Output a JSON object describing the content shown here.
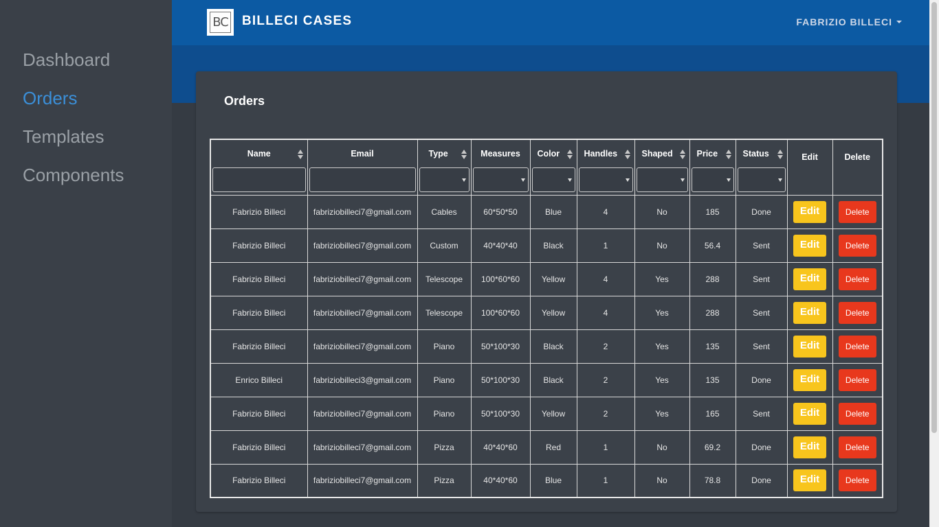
{
  "brand": {
    "logo_text": "BC",
    "name": "BILLECI CASES"
  },
  "user": {
    "name": "FABRIZIO BILLECI"
  },
  "sidebar": {
    "items": [
      {
        "label": "Dashboard"
      },
      {
        "label": "Orders"
      },
      {
        "label": "Templates"
      },
      {
        "label": "Components"
      }
    ],
    "active": "Orders"
  },
  "card": {
    "title": "Orders"
  },
  "table": {
    "columns": {
      "name": "Name",
      "email": "Email",
      "type": "Type",
      "measures": "Measures",
      "color": "Color",
      "handles": "Handles",
      "shaped": "Shaped",
      "price": "Price",
      "status": "Status",
      "edit": "Edit",
      "delete": "Delete"
    },
    "buttons": {
      "edit": "Edit",
      "delete": "Delete"
    },
    "rows": [
      {
        "name": "Fabrizio Billeci",
        "email": "fabriziobilleci7@gmail.com",
        "type": "Cables",
        "measures": "60*50*50",
        "color": "Blue",
        "handles": "4",
        "shaped": "No",
        "price": "185",
        "status": "Done"
      },
      {
        "name": "Fabrizio Billeci",
        "email": "fabriziobilleci7@gmail.com",
        "type": "Custom",
        "measures": "40*40*40",
        "color": "Black",
        "handles": "1",
        "shaped": "No",
        "price": "56.4",
        "status": "Sent"
      },
      {
        "name": "Fabrizio Billeci",
        "email": "fabriziobilleci7@gmail.com",
        "type": "Telescope",
        "measures": "100*60*60",
        "color": "Yellow",
        "handles": "4",
        "shaped": "Yes",
        "price": "288",
        "status": "Sent"
      },
      {
        "name": "Fabrizio Billeci",
        "email": "fabriziobilleci7@gmail.com",
        "type": "Telescope",
        "measures": "100*60*60",
        "color": "Yellow",
        "handles": "4",
        "shaped": "Yes",
        "price": "288",
        "status": "Sent"
      },
      {
        "name": "Fabrizio Billeci",
        "email": "fabriziobilleci7@gmail.com",
        "type": "Piano",
        "measures": "50*100*30",
        "color": "Black",
        "handles": "2",
        "shaped": "Yes",
        "price": "135",
        "status": "Sent"
      },
      {
        "name": "Enrico Billeci",
        "email": "fabriziobilleci3@gmail.com",
        "type": "Piano",
        "measures": "50*100*30",
        "color": "Black",
        "handles": "2",
        "shaped": "Yes",
        "price": "135",
        "status": "Done"
      },
      {
        "name": "Fabrizio Billeci",
        "email": "fabriziobilleci7@gmail.com",
        "type": "Piano",
        "measures": "50*100*30",
        "color": "Yellow",
        "handles": "2",
        "shaped": "Yes",
        "price": "165",
        "status": "Sent"
      },
      {
        "name": "Fabrizio Billeci",
        "email": "fabriziobilleci7@gmail.com",
        "type": "Pizza",
        "measures": "40*40*60",
        "color": "Red",
        "handles": "1",
        "shaped": "No",
        "price": "69.2",
        "status": "Done"
      },
      {
        "name": "Fabrizio Billeci",
        "email": "fabriziobilleci7@gmail.com",
        "type": "Pizza",
        "measures": "40*40*60",
        "color": "Blue",
        "handles": "1",
        "shaped": "No",
        "price": "78.8",
        "status": "Done"
      }
    ]
  },
  "colors": {
    "sidebar_bg": "#3a4048",
    "active": "#3b8fd8",
    "topbar": "#0c5aa3",
    "edit_button": "#f8c51d",
    "delete_button": "#e8381d"
  }
}
